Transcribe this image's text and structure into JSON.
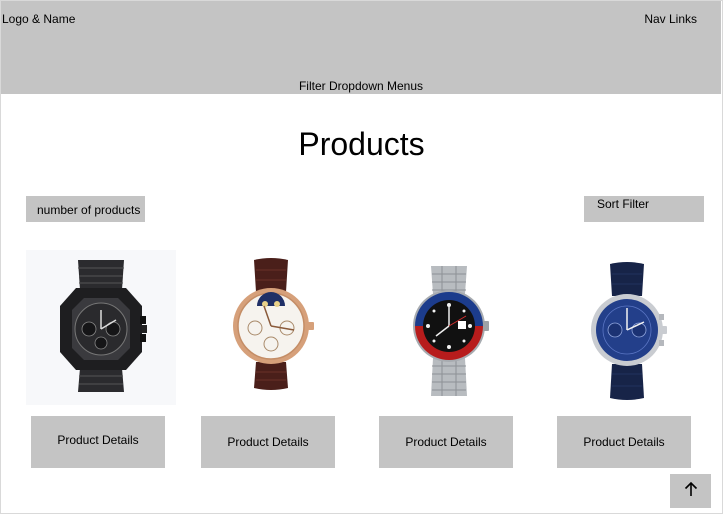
{
  "header": {
    "logo_text": "Logo & Name",
    "nav_text": "Nav Links",
    "filters_text": "Filter Dropdown Menus"
  },
  "main": {
    "title": "Products",
    "count_label": "number of products",
    "sort_label": "Sort Filter"
  },
  "products": [
    {
      "image": "black-chronograph-watch",
      "button_label": "Product Details"
    },
    {
      "image": "moonphase-leather-watch",
      "button_label": "Product Details"
    },
    {
      "image": "gmt-pepsi-bezel-watch",
      "button_label": "Product Details"
    },
    {
      "image": "blue-dial-chronograph-watch",
      "button_label": "Product Details"
    }
  ],
  "back_to_top": {
    "icon": "arrow-up-icon"
  },
  "colors": {
    "placeholder_gray": "#c4c4c4",
    "background": "#ffffff"
  }
}
